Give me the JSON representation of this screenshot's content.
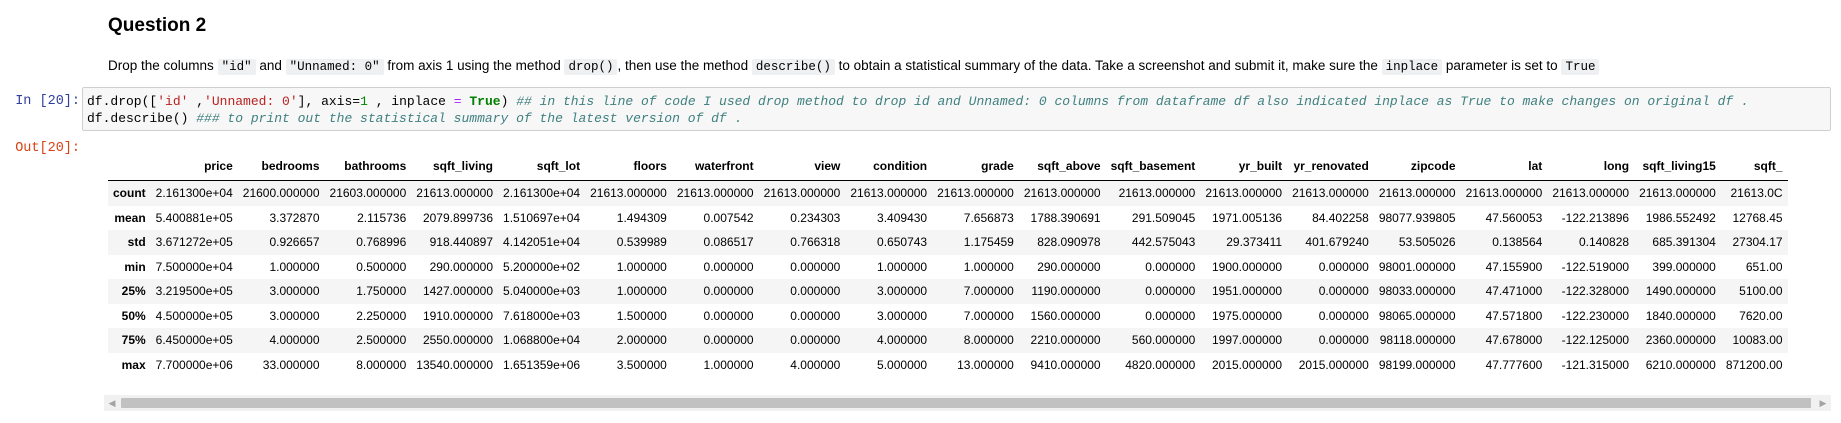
{
  "markdown": {
    "title": "Question 2",
    "instr": {
      "p1": "Drop the columns ",
      "c1": "\"id\"",
      "p2": " and ",
      "c2": "\"Unnamed: 0\"",
      "p3": " from axis 1 using the method ",
      "c3": "drop()",
      "p4": ", then use the method ",
      "c4": "describe()",
      "p5": " to obtain a statistical summary of the data. Take a screenshot and submit it, make sure the ",
      "c5": "inplace",
      "p6": " parameter is set to ",
      "c6": "True"
    }
  },
  "cell": {
    "in_prompt": "In [20]:",
    "out_prompt": "Out[20]:",
    "line1": {
      "a": "df.drop([",
      "s1": "'id'",
      "b": " ,",
      "s2": "'Unnamed: 0'",
      "c": "], axis=",
      "n1": "1",
      "d": " , inplace ",
      "eq": "=",
      "e": " ",
      "kw": "True",
      "f": ") ",
      "com": "## in this line of code I used drop method to drop id and Unnamed: 0 columns from dataframe df also indicated inplace as True to make changes on original df ."
    },
    "line2": {
      "a": "df.describe() ",
      "com": "### to print out the statistical summary of the latest version of df ."
    }
  },
  "table": {
    "columns": [
      "price",
      "bedrooms",
      "bathrooms",
      "sqft_living",
      "sqft_lot",
      "floors",
      "waterfront",
      "view",
      "condition",
      "grade",
      "sqft_above",
      "sqft_basement",
      "yr_built",
      "yr_renovated",
      "zipcode",
      "lat",
      "long",
      "sqft_living15",
      "sqft_"
    ],
    "rows": [
      {
        "label": "count",
        "values": [
          "2.161300e+04",
          "21600.000000",
          "21603.000000",
          "21613.000000",
          "2.161300e+04",
          "21613.000000",
          "21613.000000",
          "21613.000000",
          "21613.000000",
          "21613.000000",
          "21613.000000",
          "21613.000000",
          "21613.000000",
          "21613.000000",
          "21613.000000",
          "21613.000000",
          "21613.000000",
          "21613.000000",
          "21613.0C"
        ]
      },
      {
        "label": "mean",
        "values": [
          "5.400881e+05",
          "3.372870",
          "2.115736",
          "2079.899736",
          "1.510697e+04",
          "1.494309",
          "0.007542",
          "0.234303",
          "3.409430",
          "7.656873",
          "1788.390691",
          "291.509045",
          "1971.005136",
          "84.402258",
          "98077.939805",
          "47.560053",
          "-122.213896",
          "1986.552492",
          "12768.45"
        ]
      },
      {
        "label": "std",
        "values": [
          "3.671272e+05",
          "0.926657",
          "0.768996",
          "918.440897",
          "4.142051e+04",
          "0.539989",
          "0.086517",
          "0.766318",
          "0.650743",
          "1.175459",
          "828.090978",
          "442.575043",
          "29.373411",
          "401.679240",
          "53.505026",
          "0.138564",
          "0.140828",
          "685.391304",
          "27304.17"
        ]
      },
      {
        "label": "min",
        "values": [
          "7.500000e+04",
          "1.000000",
          "0.500000",
          "290.000000",
          "5.200000e+02",
          "1.000000",
          "0.000000",
          "0.000000",
          "1.000000",
          "1.000000",
          "290.000000",
          "0.000000",
          "1900.000000",
          "0.000000",
          "98001.000000",
          "47.155900",
          "-122.519000",
          "399.000000",
          "651.00"
        ]
      },
      {
        "label": "25%",
        "values": [
          "3.219500e+05",
          "3.000000",
          "1.750000",
          "1427.000000",
          "5.040000e+03",
          "1.000000",
          "0.000000",
          "0.000000",
          "3.000000",
          "7.000000",
          "1190.000000",
          "0.000000",
          "1951.000000",
          "0.000000",
          "98033.000000",
          "47.471000",
          "-122.328000",
          "1490.000000",
          "5100.00"
        ]
      },
      {
        "label": "50%",
        "values": [
          "4.500000e+05",
          "3.000000",
          "2.250000",
          "1910.000000",
          "7.618000e+03",
          "1.500000",
          "0.000000",
          "0.000000",
          "3.000000",
          "7.000000",
          "1560.000000",
          "0.000000",
          "1975.000000",
          "0.000000",
          "98065.000000",
          "47.571800",
          "-122.230000",
          "1840.000000",
          "7620.00"
        ]
      },
      {
        "label": "75%",
        "values": [
          "6.450000e+05",
          "4.000000",
          "2.500000",
          "2550.000000",
          "1.068800e+04",
          "2.000000",
          "0.000000",
          "0.000000",
          "4.000000",
          "8.000000",
          "2210.000000",
          "560.000000",
          "1997.000000",
          "0.000000",
          "98118.000000",
          "47.678000",
          "-122.125000",
          "2360.000000",
          "10083.00"
        ]
      },
      {
        "label": "max",
        "values": [
          "7.700000e+06",
          "33.000000",
          "8.000000",
          "13540.000000",
          "1.651359e+06",
          "3.500000",
          "1.000000",
          "4.000000",
          "5.000000",
          "13.000000",
          "9410.000000",
          "4820.000000",
          "2015.000000",
          "2015.000000",
          "98199.000000",
          "47.777600",
          "-121.315000",
          "6210.000000",
          "871200.00"
        ]
      }
    ]
  },
  "scrollbar": {
    "left_icon": "scroll-left-arrow",
    "right_icon": "scroll-right-arrow"
  }
}
